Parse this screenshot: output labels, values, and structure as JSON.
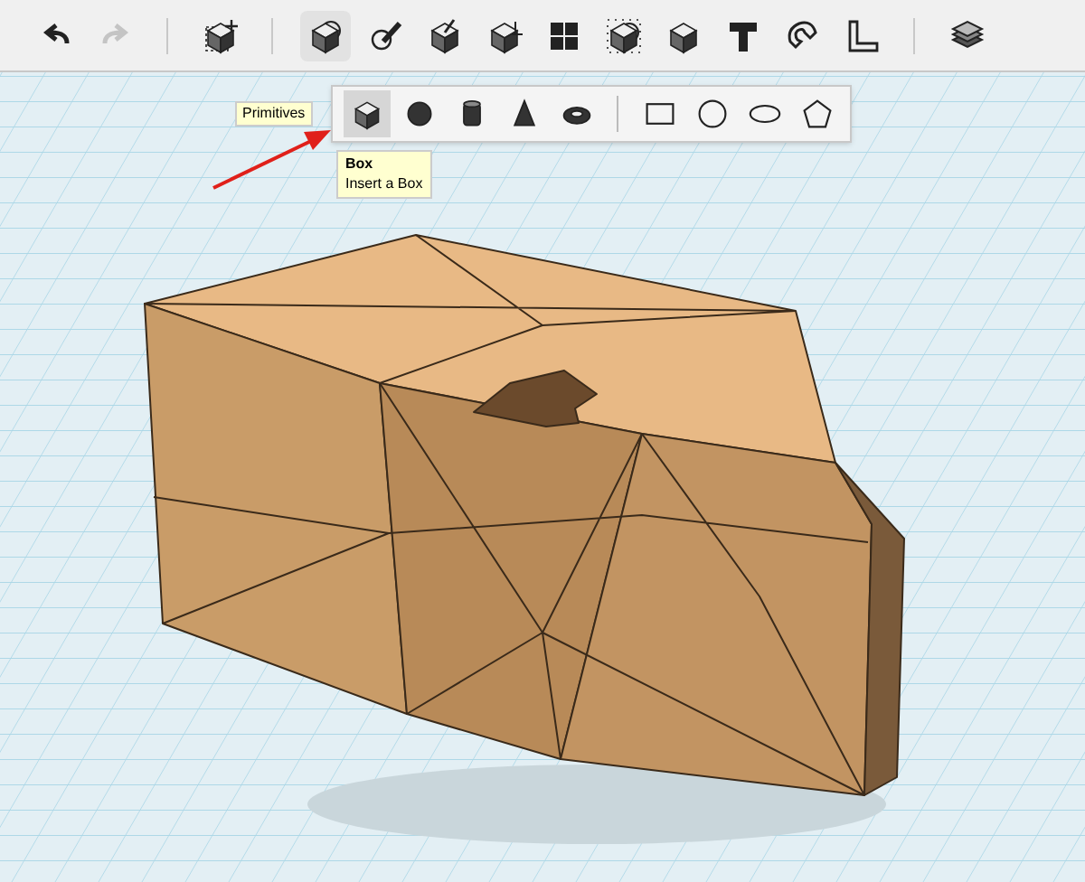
{
  "toolbar": {
    "tools": [
      {
        "kind": "undo",
        "disabled": false
      },
      {
        "kind": "redo",
        "disabled": true
      },
      {
        "kind": "divider"
      },
      {
        "kind": "transform"
      },
      {
        "kind": "divider"
      },
      {
        "kind": "primitives",
        "selected": true
      },
      {
        "kind": "sketch",
        "selected": false
      },
      {
        "kind": "construct",
        "selected": false
      },
      {
        "kind": "modify",
        "selected": false
      },
      {
        "kind": "pattern",
        "selected": false
      },
      {
        "kind": "group",
        "selected": false
      },
      {
        "kind": "combine",
        "selected": false
      },
      {
        "kind": "text",
        "selected": false
      },
      {
        "kind": "snap",
        "selected": false
      },
      {
        "kind": "measure",
        "selected": false
      },
      {
        "kind": "divider"
      },
      {
        "kind": "material",
        "selected": false
      }
    ]
  },
  "primitives_menu": {
    "tooltip": "Primitives",
    "items": [
      {
        "kind": "box",
        "selected": true
      },
      {
        "kind": "sphere",
        "selected": false
      },
      {
        "kind": "cylinder",
        "selected": false
      },
      {
        "kind": "cone",
        "selected": false
      },
      {
        "kind": "torus",
        "selected": false
      },
      {
        "kind": "divider"
      },
      {
        "kind": "rectangle",
        "selected": false
      },
      {
        "kind": "circle",
        "selected": false
      },
      {
        "kind": "ellipse",
        "selected": false
      },
      {
        "kind": "polygon",
        "selected": false
      }
    ]
  },
  "item_tooltip": {
    "title": "Box",
    "description": "Insert a Box"
  }
}
